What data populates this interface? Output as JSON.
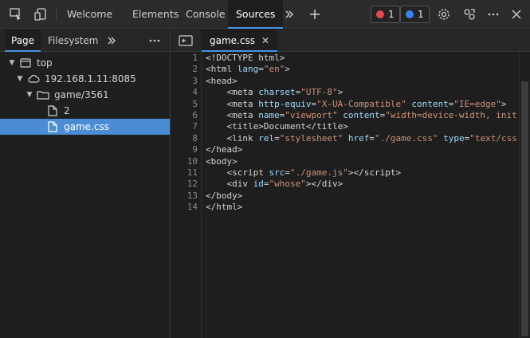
{
  "toolbar": {
    "tabs": [
      "Welcome",
      "Elements",
      "Console",
      "Sources"
    ],
    "errors_count": "1",
    "messages_count": "1",
    "error_color": "#e5484d",
    "message_color": "#3b82f6"
  },
  "navigator": {
    "tabs": [
      "Page",
      "Filesystem"
    ],
    "tree": [
      {
        "label": "top"
      },
      {
        "label": "192.168.1.11:8085"
      },
      {
        "label": "game/3561"
      },
      {
        "label": "2"
      },
      {
        "label": "game.css"
      }
    ]
  },
  "editor": {
    "open_tab": "game.css",
    "line_numbers": [
      "1",
      "2",
      "3",
      "4",
      "5",
      "6",
      "7",
      "8",
      "9",
      "10",
      "11",
      "12",
      "13",
      "14"
    ]
  },
  "colors": {
    "accent": "#4a90e2",
    "selection": "#4a8dd6",
    "attr": "#9cdcfe",
    "string": "#ce9178"
  }
}
